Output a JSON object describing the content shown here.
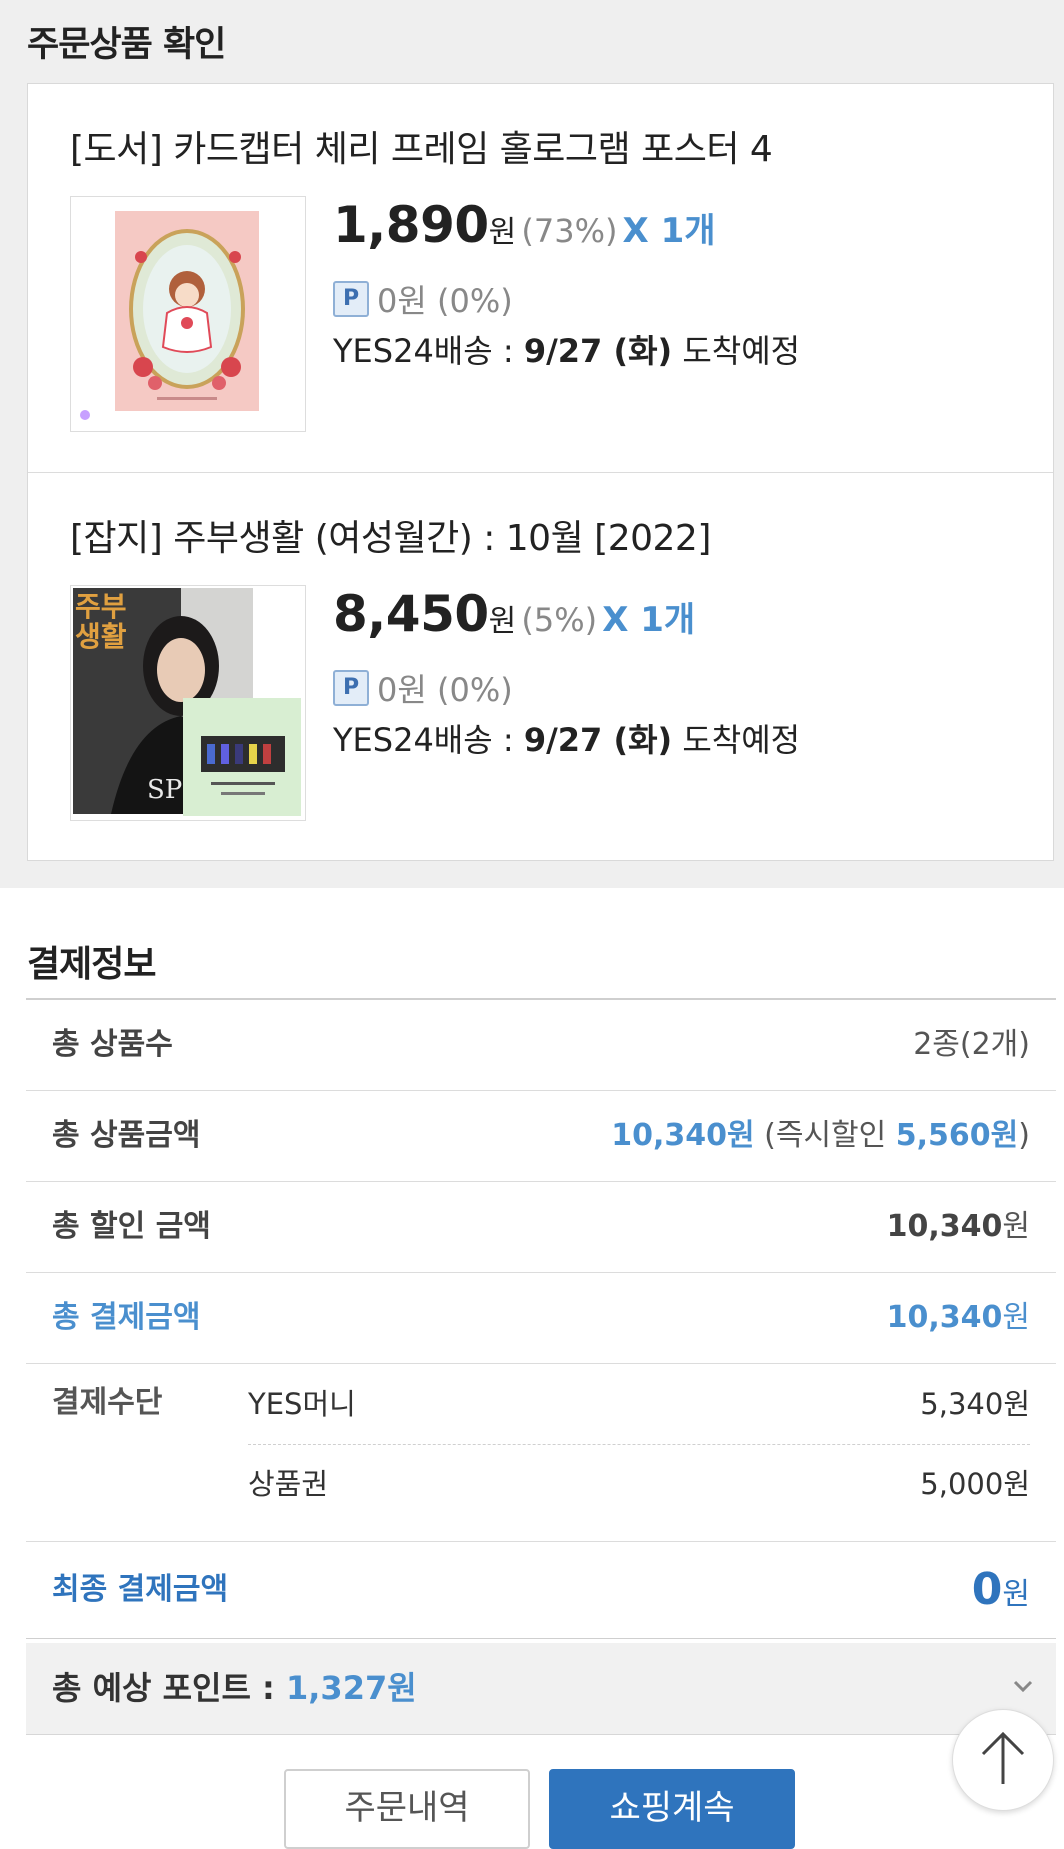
{
  "order_section": {
    "title": "주문상품 확인",
    "products": [
      {
        "title": "[도서] 카드캡터 체리 프레임 홀로그램 포스터 4",
        "price": "1,890",
        "won": "원",
        "discount": "(73%)",
        "quantity": "X 1개",
        "point_badge": "P",
        "point_text": "0원 (0%)",
        "ship_prefix": "YES24배송 : ",
        "ship_date": "9/27 (화)",
        "ship_suffix": " 도착예정"
      },
      {
        "title": "[잡지] 주부생활 (여성월간) : 10월 [2022]",
        "price": "8,450",
        "won": "원",
        "discount": "(5%)",
        "quantity": "X 1개",
        "point_badge": "P",
        "point_text": "0원 (0%)",
        "ship_prefix": "YES24배송 : ",
        "ship_date": "9/27 (화)",
        "ship_suffix": " 도착예정",
        "cover_text_1": "주부",
        "cover_text_2": "생활",
        "cover_sub": "SP"
      }
    ]
  },
  "payment": {
    "title": "결제정보",
    "total_items_label": "총 상품수",
    "total_items_value": "2종(2개)",
    "total_amount_label": "총 상품금액",
    "total_amount_value": "10,340원",
    "instant_discount_prefix": "(즉시할인 ",
    "instant_discount_value": "5,560원",
    "instant_discount_suffix": ")",
    "discount_total_label": "총 할인 금액",
    "discount_total_number": "10,340",
    "discount_total_won": "원",
    "pay_total_label": "총 결제금액",
    "pay_total_number": "10,340",
    "pay_total_won": "원",
    "method_label": "결제수단",
    "methods": [
      {
        "name": "YES머니",
        "amount": "5,340원"
      },
      {
        "name": "상품권",
        "amount": "5,000원"
      }
    ],
    "final_label": "최종 결제금액",
    "final_number": "0",
    "final_won": "원",
    "points_label": "총 예상 포인트 : ",
    "points_value": "1,327원"
  },
  "buttons": {
    "history": "주문내역",
    "continue": "쇼핑계속"
  },
  "colors": {
    "accent_blue": "#4a8fce",
    "dark_blue": "#2f74bd",
    "section_bg": "#efefef"
  }
}
